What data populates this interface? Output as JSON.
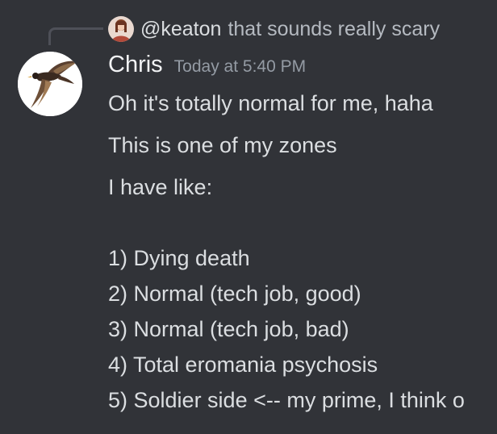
{
  "reply": {
    "username": "@keaton",
    "preview": "that sounds really scary",
    "avatar_icon": "user-avatar-icon"
  },
  "message": {
    "author": "Chris",
    "timestamp": "Today at 5:40 PM",
    "avatar_icon": "bird-avatar-icon",
    "lines": [
      "Oh it's totally normal for me, haha",
      "This is one of my zones",
      "I have like:",
      "1) Dying death",
      "2) Normal (tech job, good)",
      "3) Normal (tech job, bad)",
      "4) Total eromania psychosis",
      "5) Soldier side <-- my prime, I think o"
    ]
  },
  "colors": {
    "background": "#313338",
    "author": "#f2f3f5",
    "text": "#dbdee1",
    "muted": "#949ba4",
    "reply_spine": "#4e5058"
  }
}
